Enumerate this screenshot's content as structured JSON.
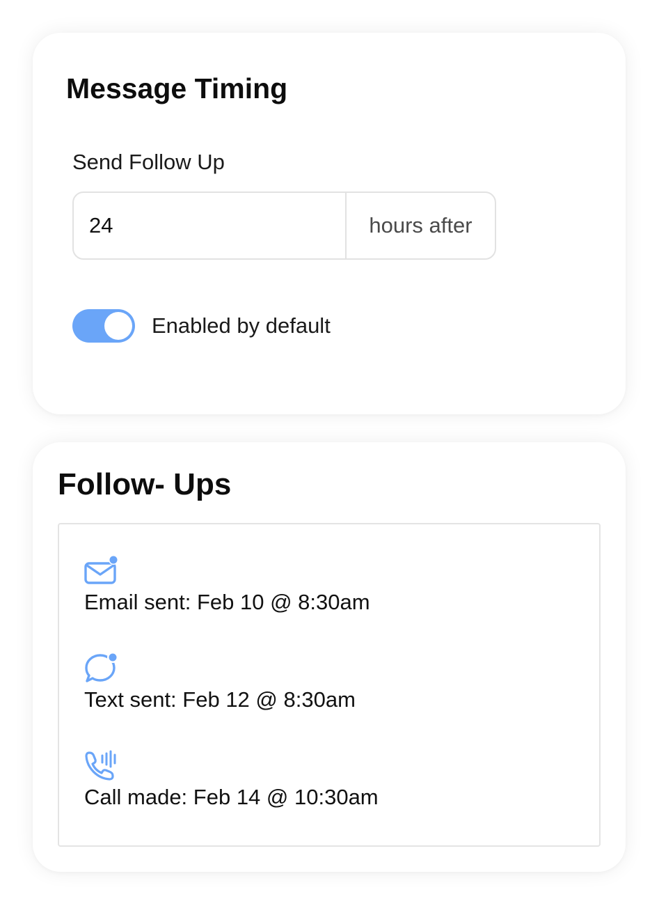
{
  "timing": {
    "title": "Message Timing",
    "send_label": "Send Follow Up",
    "hours_value": "24",
    "suffix": "hours after",
    "toggle_label": "Enabled by default",
    "toggle_on": true,
    "accent_color": "#6aa5f8"
  },
  "followups": {
    "title": "Follow- Ups",
    "items": [
      {
        "icon": "mail-notification-icon",
        "text": "Email sent: Feb 10 @ 8:30am"
      },
      {
        "icon": "chat-notification-icon",
        "text": "Text sent: Feb 12 @ 8:30am"
      },
      {
        "icon": "phone-calling-icon",
        "text": "Call made: Feb 14 @ 10:30am"
      }
    ]
  }
}
